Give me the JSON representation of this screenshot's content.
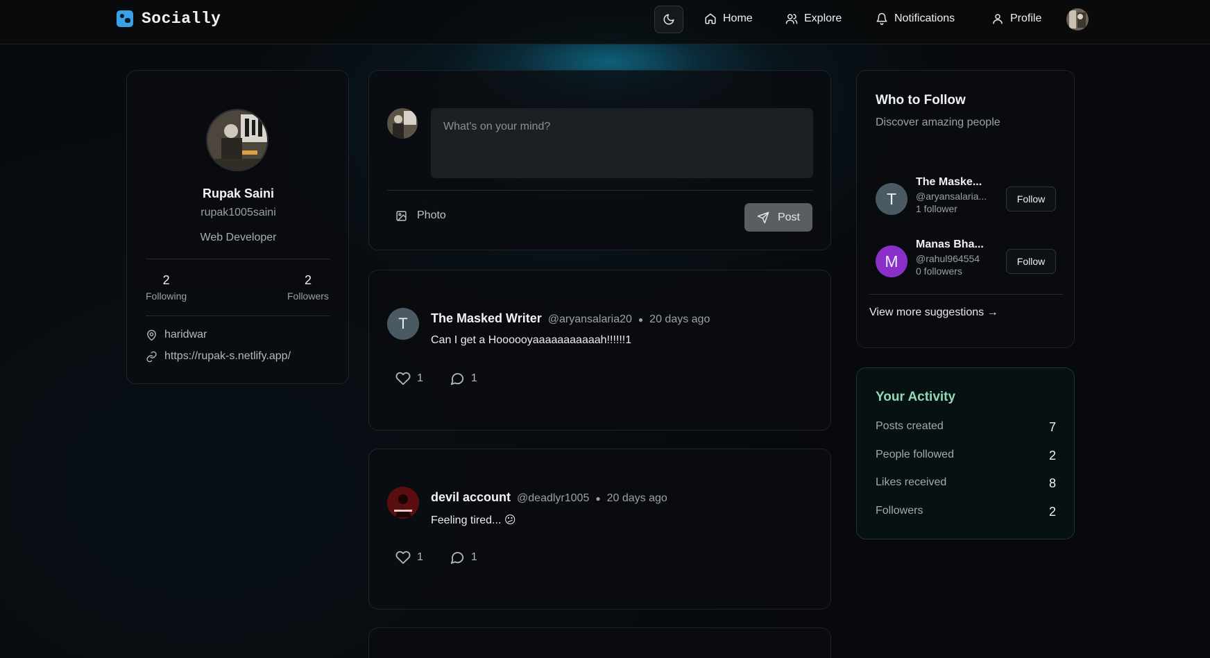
{
  "app": {
    "name": "Socially"
  },
  "nav": {
    "items": [
      {
        "label": "Home",
        "icon": "home-icon"
      },
      {
        "label": "Explore",
        "icon": "users-icon"
      },
      {
        "label": "Notifications",
        "icon": "bell-icon"
      },
      {
        "label": "Profile",
        "icon": "user-icon"
      }
    ],
    "theme_icon": "moon-icon"
  },
  "profile": {
    "name": "Rupak Saini",
    "handle": "rupak1005saini",
    "bio": "Web Developer",
    "following_count": "2",
    "following_label": "Following",
    "followers_count": "2",
    "followers_label": "Followers",
    "location": "haridwar",
    "website": "https://rupak-s.netlify.app/"
  },
  "composer": {
    "placeholder": "What's on your mind?",
    "photo_label": "Photo",
    "post_label": "Post"
  },
  "posts": [
    {
      "author": "The Masked Writer",
      "handle": "@aryansalaria20",
      "time": "20 days ago",
      "body": "Can I get a Hoooooyaaaaaaaaaaah!!!!!!1",
      "likes": "1",
      "comments": "1",
      "avatar_letter": "T",
      "avatar_color": "#4a5a63"
    },
    {
      "author": "devil account",
      "handle": "@deadlyr1005",
      "time": "20 days ago",
      "body": "Feeling tired... 😕",
      "likes": "1",
      "comments": "1",
      "avatar_color": "#5a0e10"
    }
  ],
  "who_to_follow": {
    "title": "Who to Follow",
    "subtitle": "Discover amazing people",
    "suggestions": [
      {
        "name": "The Maske...",
        "handle": "@aryansalaria...",
        "followers": "1 follower",
        "letter": "T",
        "color": "#4a5a63",
        "button": "Follow"
      },
      {
        "name": "Manas Bha...",
        "handle": "@rahul964554",
        "followers": "0 followers",
        "letter": "M",
        "color": "#8b2fc9",
        "button": "Follow"
      }
    ],
    "more_label": "View more suggestions →"
  },
  "activity": {
    "title": "Your Activity",
    "rows": [
      {
        "label": "Posts created",
        "value": "7"
      },
      {
        "label": "People followed",
        "value": "2"
      },
      {
        "label": "Likes received",
        "value": "8"
      },
      {
        "label": "Followers",
        "value": "2"
      }
    ]
  },
  "colors": {
    "accent_green": "#8fd9b6",
    "brand_blue": "#3aa0e8"
  }
}
